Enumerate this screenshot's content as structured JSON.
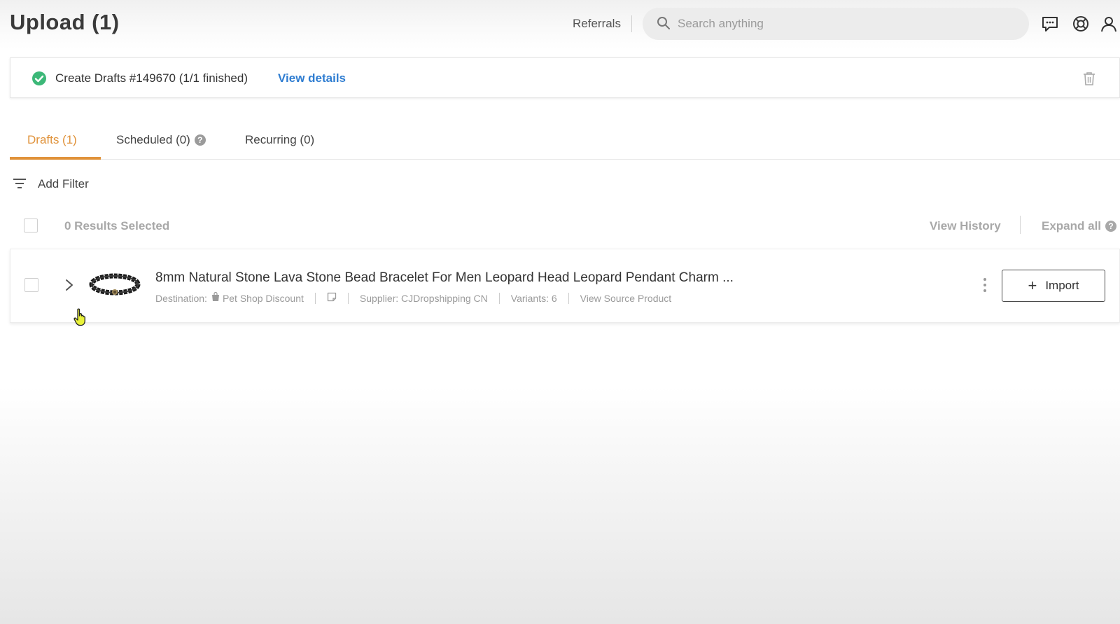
{
  "header": {
    "title": "Upload (1)",
    "referrals_label": "Referrals",
    "search_placeholder": "Search anything",
    "icons": [
      "chat-icon",
      "help-lifebuoy-icon",
      "user-icon"
    ]
  },
  "notice": {
    "status_icon": "check-circle-icon",
    "text": "Create Drafts #149670 (1/1 finished)",
    "link": "View details",
    "action_icon": "trash-icon"
  },
  "tabs": [
    {
      "label": "Drafts (1)",
      "active": true
    },
    {
      "label": "Scheduled (0)",
      "help": "?"
    },
    {
      "label": "Recurring (0)"
    }
  ],
  "filter": {
    "label": "Add Filter"
  },
  "selection": {
    "results_label": "0 Results Selected",
    "view_history": "View History",
    "expand_all": "Expand all",
    "expand_help": "?"
  },
  "product": {
    "title": "8mm Natural Stone Lava Stone Bead Bracelet For Men Leopard Head Leopard Pendant Charm ...",
    "destination_label": "Destination:",
    "destination_store": "Pet Shop Discount",
    "supplier": "Supplier: CJDropshipping CN",
    "variants": "Variants: 6",
    "source_link": "View Source Product",
    "import_label": "Import"
  },
  "colors": {
    "accent": "#e0923a",
    "link": "#2f7dd1",
    "success": "#3cb878"
  }
}
